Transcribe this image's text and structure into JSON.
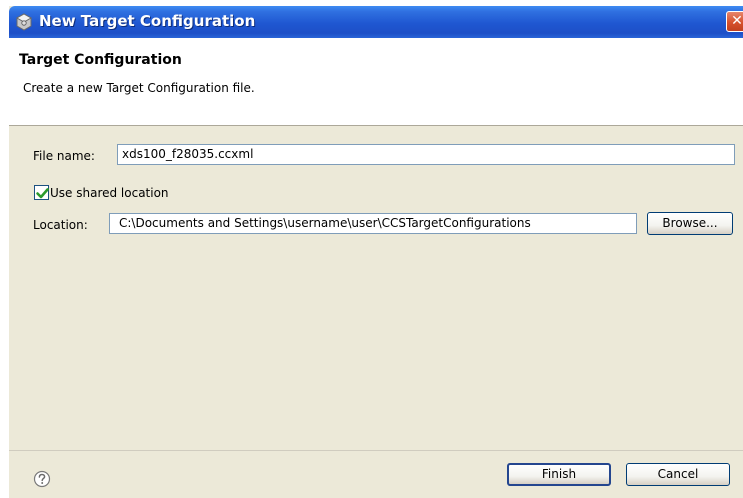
{
  "window": {
    "title": "New Target Configuration",
    "close_glyph": "✕"
  },
  "header": {
    "title": "Target Configuration",
    "subtitle": "Create a new Target Configuration file."
  },
  "form": {
    "file_name_label": "File name:",
    "file_name_value": "xds100_f28035.ccxml",
    "use_shared_label": "Use shared location",
    "use_shared_checked": true,
    "location_label": "Location:",
    "location_value": "C:\\Documents and Settings\\username\\user\\CCSTargetConfigurations",
    "browse_label": "Browse..."
  },
  "footer": {
    "finish_label": "Finish",
    "cancel_label": "Cancel"
  },
  "icons": {
    "titlebar": "target-config-icon",
    "help": "help-icon",
    "check": "check-icon"
  },
  "colors": {
    "titlebar": "#1f57d1",
    "dialog_bg": "#ece9d8",
    "checkmark": "#2c9a2c",
    "close": "#d6512d"
  }
}
